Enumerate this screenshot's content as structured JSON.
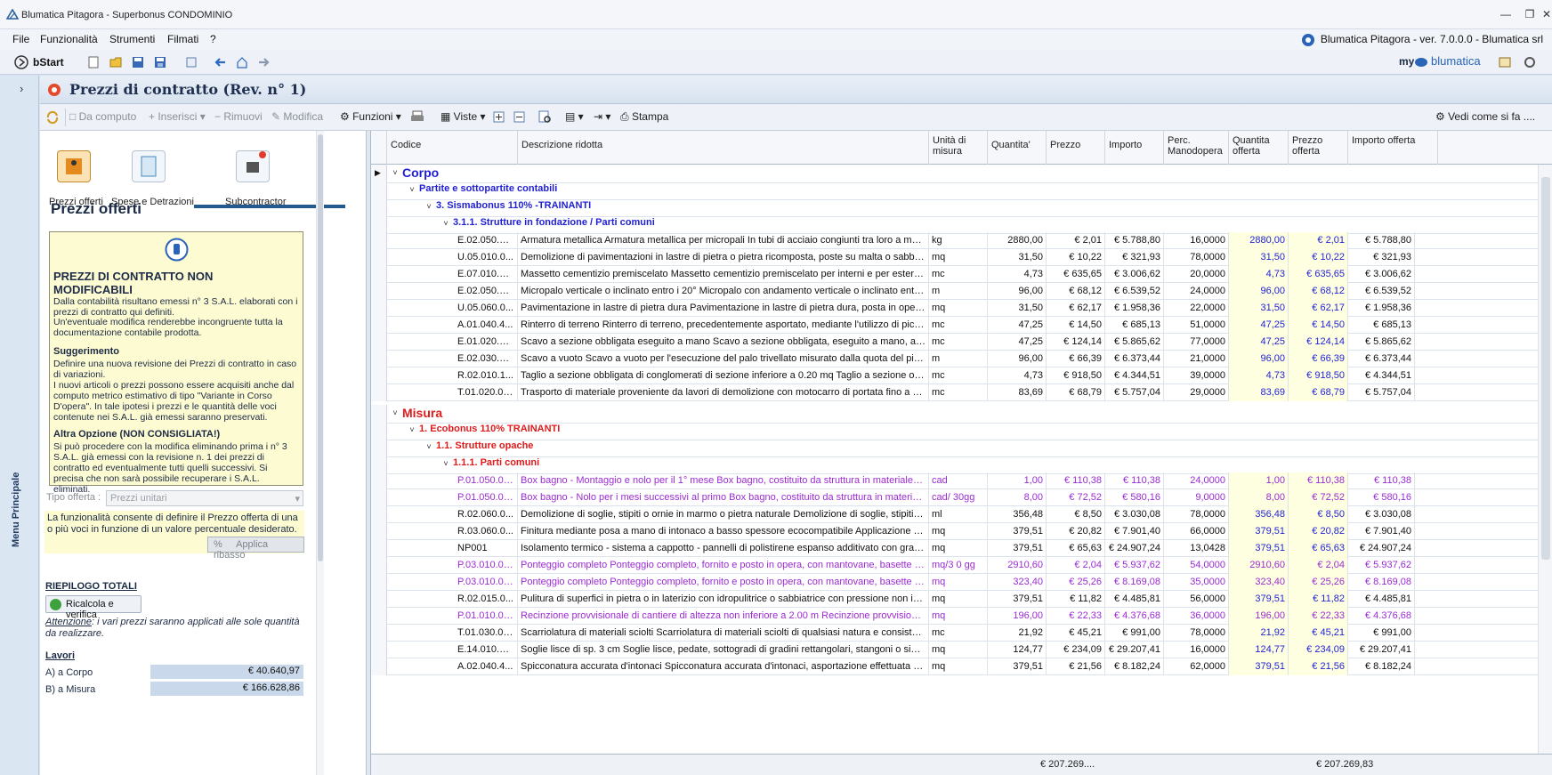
{
  "window": {
    "title": "Blumatica Pitagora - Superbonus CONDOMINIO"
  },
  "menu": [
    "File",
    "Funzionalità",
    "Strumenti",
    "Filmati",
    "?"
  ],
  "brand_version": "Blumatica Pitagora - ver. 7.0.0.0 - Blumatica srl",
  "toolbar1": {
    "bstart": "bStart",
    "brand_my": "my",
    "brand_name": "blumatica"
  },
  "sidebar": {
    "label": "Menu Principale"
  },
  "panel": {
    "title": "Prezzi di contratto (Rev. n° 1)"
  },
  "toolbar2": {
    "da_computo": "Da computo",
    "inserisci": "Inserisci",
    "rimuovi": "Rimuovi",
    "modifica": "Modifica",
    "funzioni": "Funzioni",
    "viste": "Viste",
    "stampa": "Stampa",
    "vedi": "Vedi come si fa ...."
  },
  "left": {
    "icons": [
      "Prezzi offerti",
      "Spese e Detrazioni",
      "Subcontractor"
    ],
    "title": "Prezzi offerti",
    "info": {
      "head": "PREZZI DI CONTRATTO NON MODIFICABILI",
      "p1": "Dalla contabilità risultano emessi n° 3 S.A.L. elaborati con i prezzi di contratto qui definiti.",
      "p2": "Un'eventuale modifica renderebbe incongruente tutta la documentazione contabile prodotta.",
      "sugg_title": "Suggerimento",
      "sugg": "Definire una nuova revisione dei Prezzi di contratto in caso di variazioni.",
      "sugg2": "I nuovi articoli o prezzi possono essere acquisiti anche dal computo metrico estimativo di tipo \"Variante in Corso D'opera\". In tale ipotesi i prezzi e le quantità delle voci contenute nei S.A.L. già emessi saranno preservati.",
      "alt_title": "Altra Opzione (NON CONSIGLIATA!)",
      "alt": "Si può procedere con la modifica eliminando prima i n° 3 S.A.L. già emessi con la revisione n. 1 dei prezzi di contratto ed eventualmente tutti quelli successivi. Si precisa che non sarà possibile recuperare i S.A.L. eliminati."
    },
    "tipo_label": "Tipo offerta :",
    "tipo_value": "Prezzi unitari",
    "func_desc": "La funzionalità consente di definire il Prezzo offerta di una o più voci in funzione di un valore percentuale desiderato.",
    "ribasso_pct": "%",
    "ribasso": "Applica ribasso",
    "riepilogo": "RIEPILOGO TOTALI",
    "ricalcola": "Ricalcola e verifica",
    "attenzione_label": "Attenzione",
    "attenzione": ": i vari prezzi saranno applicati alle sole quantità da realizzare.",
    "lavori": "Lavori",
    "a_corpo_label": "A) a Corpo",
    "a_corpo_value": "€ 40.640,97",
    "b_label": "B) a Misura",
    "b_value": "€ 166.628,86"
  },
  "grid": {
    "headers": [
      "Codice",
      "Descrizione ridotta",
      "Unità di misura",
      "Quantita'",
      "Prezzo",
      "Importo",
      "Perc. Manodopera",
      "Quantita offerta",
      "Prezzo offerta",
      "Importo offerta"
    ],
    "groups": {
      "corpo": "Corpo",
      "partite": "Partite e sottopartite contabili",
      "sisma": "3.  Sismabonus 110% -TRAINANTI",
      "fond": "3.1.1.  Strutture in fondazione / Parti comuni",
      "misura": "Misura",
      "eco": "1. Ecobonus 110% TRAINANTI",
      "opache": "1.1. Strutture opache",
      "comuni": "1.1.1. Parti comuni"
    },
    "rows_corpo": [
      [
        "E.02.050.08...",
        "Armatura metallica Armatura metallica per micropali In tubi di acciaio congiunti tra loro a mezzo saldatura...",
        "kg",
        "2880,00",
        "€ 2,01",
        "€ 5.788,80",
        "16,0000",
        "2880,00",
        "€ 2,01",
        "€ 5.788,80"
      ],
      [
        "U.05.010.0...",
        "Demolizione di pavimentazioni in lastre di pietra o pietra ricomposta, poste su malta o sabbia Demol ... n...",
        "mq",
        "31,50",
        "€ 10,22",
        "€ 321,93",
        "78,0000",
        "31,50",
        "€ 10,22",
        "€ 321,93"
      ],
      [
        "E.07.010.10...",
        "Massetto cementizio premiscelato Massetto cementizio premiscelato per interni e per esterni additiva ......",
        "mc",
        "4,73",
        "€ 635,65",
        "€ 3.006,62",
        "20,0000",
        "4,73",
        "€ 635,65",
        "€ 3.006,62"
      ],
      [
        "E.02.050.01...",
        "Micropalo verticale o inclinato entro i 20° Micropalo con andamento verticale o inclinato entro 20 g ... to...",
        "m",
        "96,00",
        "€ 68,12",
        "€ 6.539,52",
        "24,0000",
        "96,00",
        "€ 68,12",
        "€ 6.539,52"
      ],
      [
        "U.05.060.0...",
        "Pavimentazione in lastre di pietra dura Pavimentazione in lastre di pietra dura, posta in opera su s ... m...",
        "mq",
        "31,50",
        "€ 62,17",
        "€ 1.958,36",
        "22,0000",
        "31,50",
        "€ 62,17",
        "€ 1.958,36"
      ],
      [
        "A.01.040.4...",
        "Rinterro di terreno Rinterro di terreno, precedentemente asportato, mediante l'utilizzo di piccolo mezzo ...",
        "mc",
        "47,25",
        "€ 14,50",
        "€ 685,13",
        "51,0000",
        "47,25",
        "€ 14,50",
        "€ 685,13"
      ],
      [
        "E.01.020.02...",
        "Scavo a sezione obbligata eseguito a mano Scavo a sezione obbligata, eseguito a mano, anche in pres...",
        "mc",
        "47,25",
        "€ 124,14",
        "€ 5.865,62",
        "77,0000",
        "47,25",
        "€ 124,14",
        "€ 5.865,62"
      ],
      [
        "E.02.030.03...",
        "Scavo a vuoto Scavo a vuoto per l'esecuzione del palo trivellato misurato dalla quota del piano effettiv...",
        "m",
        "96,00",
        "€ 66,39",
        "€ 6.373,44",
        "21,0000",
        "96,00",
        "€ 66,39",
        "€ 6.373,44"
      ],
      [
        "R.02.010.1...",
        "Taglio a sezione obbligata di conglomerati di sezione inferiore a 0.20 mq Taglio a sezione obbligata di co...",
        "mc",
        "4,73",
        "€ 918,50",
        "€ 4.344,51",
        "39,0000",
        "4,73",
        "€ 918,50",
        "€ 4.344,51"
      ],
      [
        "T.01.020.02...",
        "Trasporto di materiale proveniente da lavori di demolizione con motocarro di portata fino a 1 mc Tra ......",
        "mc",
        "83,69",
        "€ 68,79",
        "€ 5.757,04",
        "29,0000",
        "83,69",
        "€ 68,79",
        "€ 5.757,04"
      ]
    ],
    "rows_misura": [
      [
        "P.01.050.03...",
        "Box bagno - Montaggio e nolo per il 1° mese Box bagno, costituito da struttura in materiale plastico ......",
        "cad",
        "1,00",
        "€ 110,38",
        "€ 110,38",
        "24,0000",
        "1,00",
        "€ 110,38",
        "€ 110,38",
        "p"
      ],
      [
        "P.01.050.04...",
        "Box bagno - Nolo per i mesi successivi al primo Box bagno, costituito da struttura in materiale plas ... ul...",
        "cad/ 30gg",
        "8,00",
        "€ 72,52",
        "€ 580,16",
        "9,0000",
        "8,00",
        "€ 72,52",
        "€ 580,16",
        "p"
      ],
      [
        "R.02.060.0...",
        "Demolizione di soglie, stipiti o ornie in marmo o pietra naturale Demolizione di soglie, stipiti o o ... ovviso...",
        "ml",
        "356,48",
        "€ 8,50",
        "€ 3.030,08",
        "78,0000",
        "356,48",
        "€ 8,50",
        "€ 3.030,08",
        "n"
      ],
      [
        "R.03.060.0...",
        "Finitura mediante posa a mano di intonaco a basso spessore ecocompatibile Applicazione di finitura m ......",
        "mq",
        "379,51",
        "€ 20,82",
        "€ 7.901,40",
        "66,0000",
        "379,51",
        "€ 20,82",
        "€ 7.901,40",
        "n"
      ],
      [
        "NP001",
        "Isolamento termico - sistema a cappotto - pannelli di polistirene espanso additivato con grafite Iso ... o ...",
        "mq",
        "379,51",
        "€ 65,63",
        "€ 24.907,24",
        "13,0428",
        "379,51",
        "€ 65,63",
        "€ 24.907,24",
        "n"
      ],
      [
        "P.03.010.03...",
        "Ponteggio completo Ponteggio completo, fornito e posto in opera, con mantovane, basette supporti ag...",
        "mq/3 0 gg",
        "2910,60",
        "€ 2,04",
        "€ 5.937,62",
        "54,0000",
        "2910,60",
        "€ 2,04",
        "€ 5.937,62",
        "p"
      ],
      [
        "P.03.010.03...",
        "Ponteggio completo Ponteggio completo, fornito e posto in opera, con mantovane, basette supporti ag...",
        "mq",
        "323,40",
        "€ 25,26",
        "€ 8.169,08",
        "35,0000",
        "323,40",
        "€ 25,26",
        "€ 8.169,08",
        "p"
      ],
      [
        "R.02.015.0...",
        "Pulitura di superfici in pietra o in laterizio con idropulitrice o sabbiatrice con pressione non inf ... 0÷30 a...",
        "mq",
        "379,51",
        "€ 11,82",
        "€ 4.485,81",
        "56,0000",
        "379,51",
        "€ 11,82",
        "€ 4.485,81",
        "n"
      ],
      [
        "P.01.010.01...",
        "Recinzione provvisionale di cantiere di altezza non inferiore a 2.00 m Recinzione provvisionale di c ... tu...",
        "mq",
        "196,00",
        "€ 22,33",
        "€ 4.376,68",
        "36,0000",
        "196,00",
        "€ 22,33",
        "€ 4.376,68",
        "p"
      ],
      [
        "T.01.030.02...",
        "Scarriolatura di materiali sciolti Scarriolatura di materiali sciolti di qualsiasi natura e consistenza, proveni...",
        "mc",
        "21,92",
        "€ 45,21",
        "€ 991,00",
        "78,0000",
        "21,92",
        "€ 45,21",
        "€ 991,00",
        "n"
      ],
      [
        "E.14.010.02...",
        "Soglie lisce di sp. 3 cm Soglie lisce, pedate, sottogradi di gradini rettangolari, stangoni o simili ... ilatura ...",
        "mq",
        "124,77",
        "€ 234,09",
        "€ 29.207,41",
        "16,0000",
        "124,77",
        "€ 234,09",
        "€ 29.207,41",
        "n"
      ],
      [
        "A.02.040.4...",
        "Spicconatura accurata d'intonaci Spicconatura accurata d'intonaci, asportazione effettuata seguendo ...",
        "mq",
        "379,51",
        "€ 21,56",
        "€ 8.182,24",
        "62,0000",
        "379,51",
        "€ 21,56",
        "€ 8.182,24",
        "n"
      ]
    ],
    "footer": {
      "importo": "€ 207.269....",
      "importo_offerta": "€ 207.269,83"
    }
  },
  "colors": {
    "accent": "#215a8f",
    "group_blue": "#1f1fd6",
    "group_red": "#e01b1b",
    "purple": "#9b2bd4",
    "offer_bg": "#fefee0"
  }
}
